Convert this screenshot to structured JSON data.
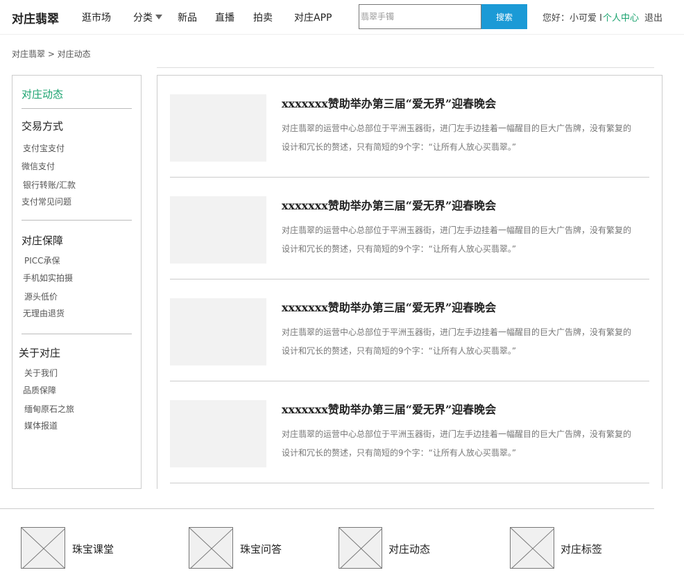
{
  "header": {
    "logo": "对庄翡翠",
    "nav": [
      "逛市场",
      "分类",
      "新品",
      "直播",
      "拍卖",
      "对庄APP"
    ],
    "search_placeholder": "翡翠手镯",
    "search_button": "搜索",
    "greeting": "您好：小可爱 I",
    "user_center": "个人中心",
    "logout": "退出"
  },
  "breadcrumb": "对庄翡翠 > 对庄动态",
  "sidebar": {
    "title": "对庄动态",
    "groups": [
      {
        "name": "交易方式",
        "items": [
          "支付宝支付",
          "微信支付",
          "银行转账/汇款",
          "支付常见问题"
        ]
      },
      {
        "name": "对庄保障",
        "items": [
          "PICC承保",
          "手机如实拍摄",
          "源头低价",
          "无理由退货"
        ]
      },
      {
        "name": "关于对庄",
        "items": [
          "关于我们",
          "品质保障",
          "缅甸原石之旅",
          "媒体报道"
        ]
      }
    ]
  },
  "articles": [
    {
      "title": "xxxxxxx赞助举办第三届“爱无界”迎春晚会",
      "desc": "对庄翡翠的运营中心总部位于平洲玉器街，进门左手边挂着一幅醒目的巨大广告牌，没有繁复的设计和冗长的赘述，只有简短的9个字：“让所有人放心买翡翠。”"
    },
    {
      "title": "xxxxxxx赞助举办第三届“爱无界”迎春晚会",
      "desc": "对庄翡翠的运营中心总部位于平洲玉器街，进门左手边挂着一幅醒目的巨大广告牌，没有繁复的设计和冗长的赘述，只有简短的9个字：“让所有人放心买翡翠。”"
    },
    {
      "title": "xxxxxxx赞助举办第三届“爱无界”迎春晚会",
      "desc": "对庄翡翠的运营中心总部位于平洲玉器街，进门左手边挂着一幅醒目的巨大广告牌，没有繁复的设计和冗长的赘述，只有简短的9个字：“让所有人放心买翡翠。”"
    },
    {
      "title": "xxxxxxx赞助举办第三届“爱无界”迎春晚会",
      "desc": "对庄翡翠的运营中心总部位于平洲玉器街，进门左手边挂着一幅醒目的巨大广告牌，没有繁复的设计和冗长的赘述，只有简短的9个字：“让所有人放心买翡翠。”"
    }
  ],
  "footer": [
    "珠宝课堂",
    "珠宝问答",
    "对庄动态",
    "对庄标签"
  ],
  "colors": {
    "accent_green": "#1aa36f",
    "search_blue": "#1b9ad6"
  }
}
